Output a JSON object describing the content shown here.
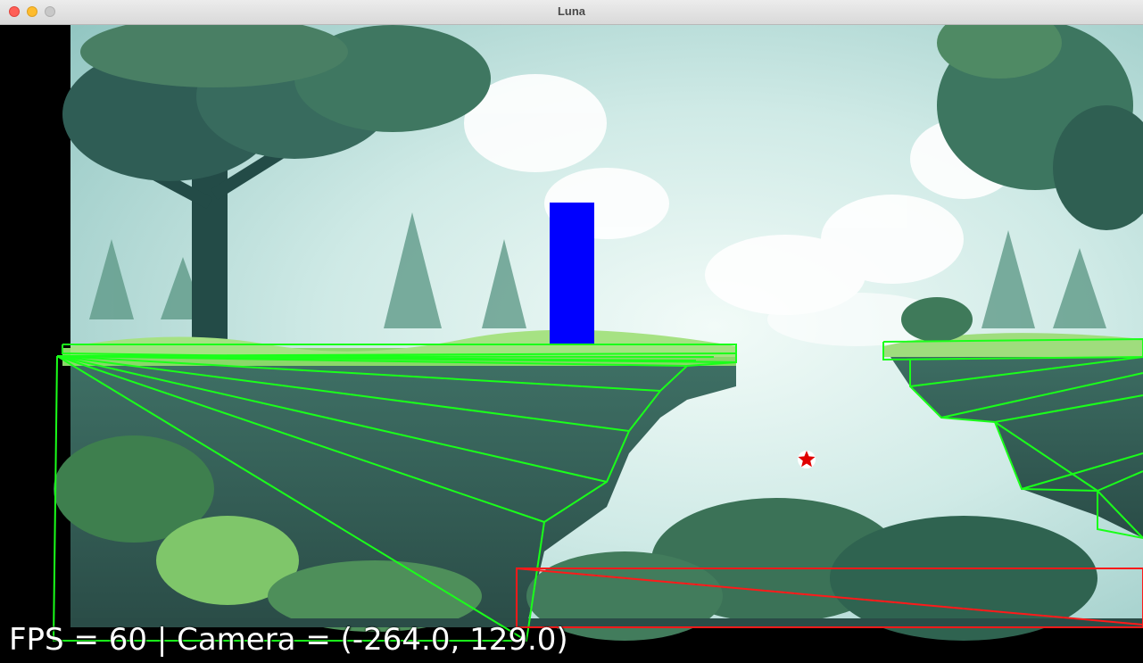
{
  "window": {
    "title": "Luna"
  },
  "hud": {
    "text": "FPS = 60 | Camera = (-264.0, 129.0)"
  },
  "colors": {
    "player": "#0000ff",
    "collision_outline": "#1aff1a",
    "trigger_outline": "#ff1a1a",
    "sky": "#bfe3e0",
    "foliage_dark": "#1f4a44",
    "foliage_mid": "#3f7a5a",
    "grass": "#8ad86a"
  },
  "icons": {
    "marker": "red-star-icon"
  }
}
